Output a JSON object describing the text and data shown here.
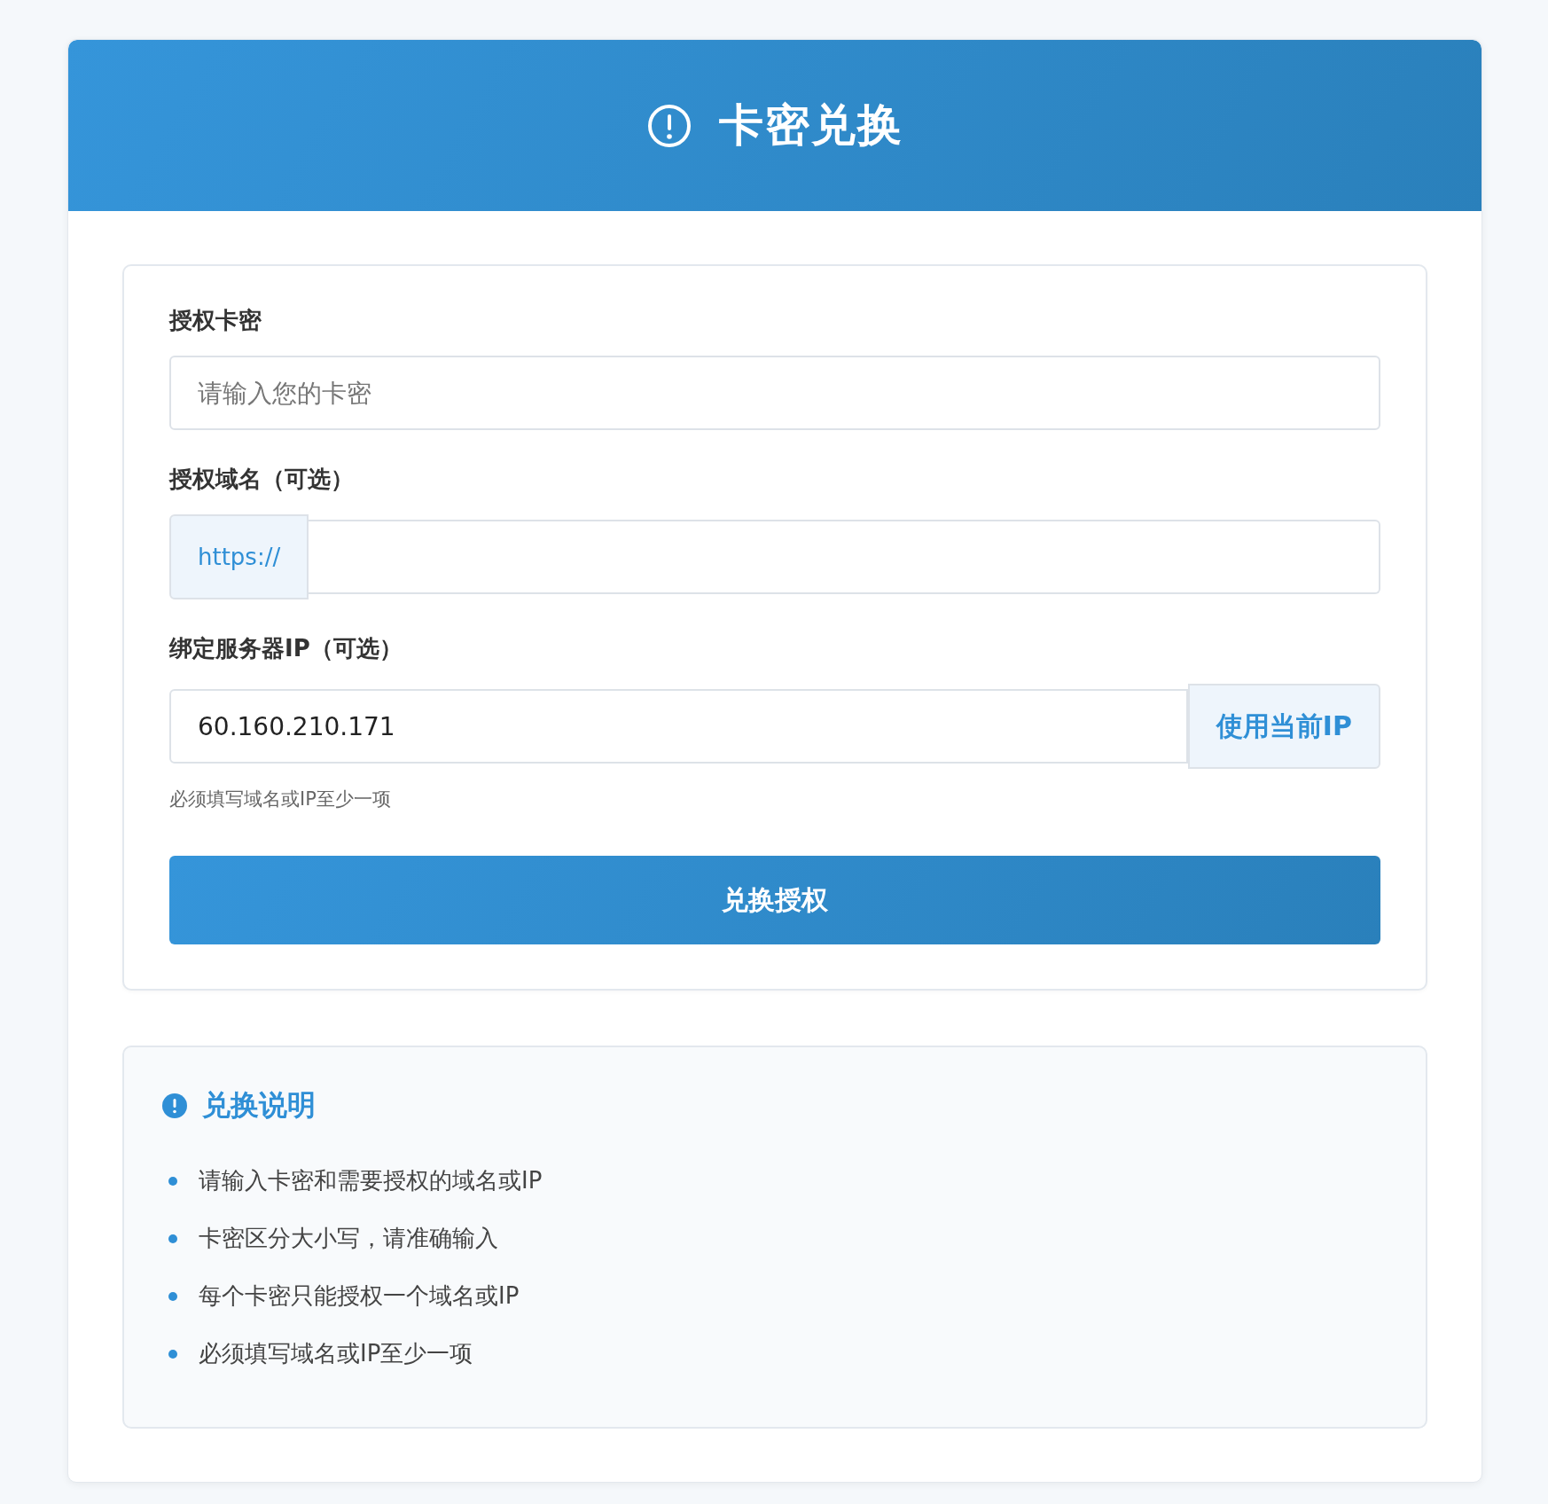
{
  "header": {
    "title": "卡密兑换"
  },
  "form": {
    "fields": [
      {
        "kind": "text",
        "label": "授权卡密",
        "placeholder": "请输入您的卡密"
      },
      {
        "kind": "prefixed",
        "label": "授权域名（可选）",
        "prefix": "https://"
      },
      {
        "kind": "button",
        "label": "绑定服务器IP（可选）",
        "value": "60.160.210.171",
        "button": "使用当前IP",
        "hint": "必须填写域名或IP至少一项"
      }
    ],
    "submit": "兑换授权"
  },
  "notes": {
    "title": "兑换说明",
    "items": [
      "请输入卡密和需要授权的域名或IP",
      "卡密区分大小写，请准确输入",
      "每个卡密只能授权一个域名或IP",
      "必须填写域名或IP至少一项"
    ]
  }
}
